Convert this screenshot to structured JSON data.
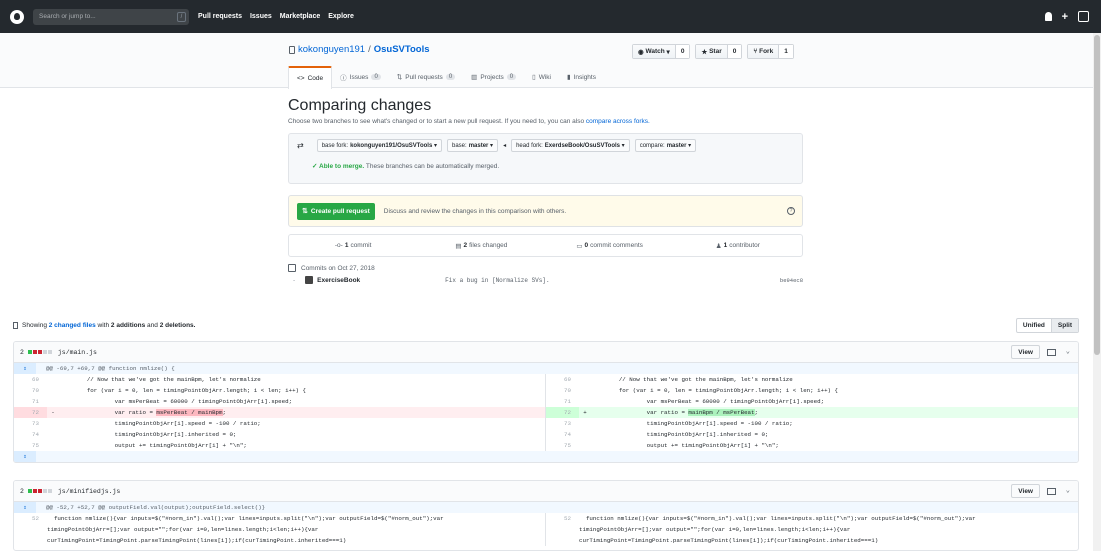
{
  "header": {
    "search_placeholder": "Search or jump to...",
    "slash_hint": "/",
    "nav": [
      "Pull requests",
      "Issues",
      "Marketplace",
      "Explore"
    ],
    "bell_icon": "bell-icon",
    "plus_label": "+",
    "avatar_icon": "avatar"
  },
  "repo": {
    "owner": "kokonguyen191",
    "separator": "/",
    "name": "OsuSVTools",
    "watch_label": "Watch",
    "watch_count": "0",
    "star_label": "Star",
    "star_count": "0",
    "fork_label": "Fork",
    "fork_count": "1",
    "tabs": [
      {
        "label": "Code",
        "count": ""
      },
      {
        "label": "Issues",
        "count": "0"
      },
      {
        "label": "Pull requests",
        "count": "0"
      },
      {
        "label": "Projects",
        "count": "0"
      },
      {
        "label": "Wiki",
        "count": ""
      },
      {
        "label": "Insights",
        "count": ""
      }
    ]
  },
  "compare": {
    "title": "Comparing changes",
    "subtitle": "Choose two branches to see what's changed or to start a new pull request. If you need to, you can also",
    "subtitle_link": "compare across forks.",
    "base_fork_label": "base fork:",
    "base_fork_value": "kokonguyen191/OsuSVTools",
    "base_label": "base:",
    "base_value": "master",
    "head_fork_label": "head fork:",
    "head_fork_value": "ExerdseBook/OsuSVTools",
    "compare_label": "compare:",
    "compare_value": "master",
    "able_to_merge": "Able to merge.",
    "merge_text": "These branches can be automatically merged.",
    "create_pr_label": "Create pull request",
    "create_pr_desc": "Discuss and review the changes in this comparison with others.",
    "help_icon": "?"
  },
  "numbers": {
    "commits_count": "1",
    "commits_label": "commit",
    "files_count": "2",
    "files_label": "files changed",
    "comments_count": "0",
    "comments_label": "commit comments",
    "contributors_count": "1",
    "contributors_label": "contributor"
  },
  "commits": {
    "date_header": "Commits on Oct 27, 2018",
    "author": "ExerciseBook",
    "message": "Fix a bug in [Normalize SVs].",
    "sha": "be94ec8"
  },
  "summary": {
    "showing": "Showing",
    "changed_files": "2 changed files",
    "with": "with",
    "additions": "2 additions",
    "and": "and",
    "deletions": "2 deletions.",
    "unified_label": "Unified",
    "split_label": "Split"
  },
  "files": [
    {
      "changes": "2",
      "name": "js/main.js",
      "view_label": "View",
      "hunk": "@@ -69,7 +69,7 @@ function nmlize() {",
      "left": [
        {
          "n": "69",
          "t": "ctx",
          "code": "        // Now that we've got the mainBpm, let's normalize"
        },
        {
          "n": "70",
          "t": "ctx",
          "code": "        for (var i = 0, len = timingPointObjArr.length; i < len; i++) {"
        },
        {
          "n": "71",
          "t": "ctx",
          "code": "                var msPerBeat = 60000 / timingPointObjArr[i].speed;"
        },
        {
          "n": "72",
          "t": "del",
          "code": "                var ratio = ",
          "hl": "msPerBeat / mainBpm",
          "tail": ";"
        },
        {
          "n": "73",
          "t": "ctx",
          "code": "                timingPointObjArr[i].speed = -100 / ratio;"
        },
        {
          "n": "74",
          "t": "ctx",
          "code": "                timingPointObjArr[i].inherited = 0;"
        },
        {
          "n": "75",
          "t": "ctx",
          "code": "                output += timingPointObjArr[i] + \"\\n\";"
        }
      ],
      "right": [
        {
          "n": "69",
          "t": "ctx",
          "code": "        // Now that we've got the mainBpm, let's normalize"
        },
        {
          "n": "70",
          "t": "ctx",
          "code": "        for (var i = 0, len = timingPointObjArr.length; i < len; i++) {"
        },
        {
          "n": "71",
          "t": "ctx",
          "code": "                var msPerBeat = 60000 / timingPointObjArr[i].speed;"
        },
        {
          "n": "72",
          "t": "add",
          "code": "                var ratio = ",
          "hl": "mainBpm / msPerBeat",
          "tail": ";"
        },
        {
          "n": "73",
          "t": "ctx",
          "code": "                timingPointObjArr[i].speed = -100 / ratio;"
        },
        {
          "n": "74",
          "t": "ctx",
          "code": "                timingPointObjArr[i].inherited = 0;"
        },
        {
          "n": "75",
          "t": "ctx",
          "code": "                output += timingPointObjArr[i] + \"\\n\";"
        }
      ]
    },
    {
      "changes": "2",
      "name": "js/minifiedjs.js",
      "view_label": "View",
      "hunk": "@@ -52,7 +52,7 @@ outputField.val(output);outputField.select()}",
      "left_n": "52",
      "left_code": "  function nmlize(){var inputs=$(\"#norm_in\").val();var lines=inputs.split(\"\\n\");var outputField=$(\"#norm_out\");var\ntimingPointObjArr=[];var output=\"\";for(var i=0,len=lines.length;i<len;i++){var\ncurTimingPoint=TimingPoint.parseTimingPoint(lines[i]);if(curTimingPoint.inherited===1)",
      "right_n": "52",
      "right_code": "  function nmlize(){var inputs=$(\"#norm_in\").val();var lines=inputs.split(\"\\n\");var outputField=$(\"#norm_out\");var\ntimingPointObjArr=[];var output=\"\";for(var i=0,len=lines.length;i<len;i++){var\ncurTimingPoint=TimingPoint.parseTimingPoint(lines[i]);if(curTimingPoint.inherited===1)"
    }
  ],
  "colors": {
    "header_bg": "#24292e",
    "link": "#0366d6",
    "green": "#28a745",
    "del_bg": "#ffeef0",
    "add_bg": "#e6ffed",
    "stat_add": "#2cbe4e",
    "stat_del": "#cb2431",
    "stat_neutral": "#d1d5da"
  }
}
